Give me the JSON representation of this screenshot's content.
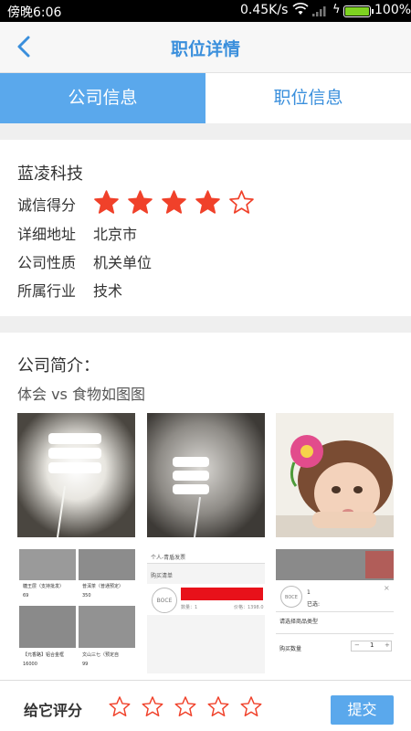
{
  "status_bar": {
    "time": "傍晚6:06",
    "speed": "0.45K/s",
    "battery": "100%"
  },
  "nav": {
    "title": "职位详情"
  },
  "tabs": [
    {
      "label": "公司信息"
    },
    {
      "label": "职位信息"
    }
  ],
  "company": {
    "name": "蓝凌科技",
    "rating_label": "诚信得分",
    "rating": 4,
    "rating_max": 5,
    "address_label": "详细地址",
    "address": "北京市",
    "nature_label": "公司性质",
    "nature": "机关单位",
    "industry_label": "所属行业",
    "industry": "技术"
  },
  "intro": {
    "title": "公司简介：",
    "text": "体会 vs 食物如图图",
    "shot1": {
      "cells": [
        {
          "name": "糖王层（支持批发）",
          "price": "69"
        },
        {
          "name": "普洱茶（普通预定）",
          "price": "350"
        },
        {
          "name": "【元香路】铝合金框",
          "price": "16000"
        },
        {
          "name": "文山三七（预定自",
          "price": "99"
        }
      ]
    },
    "shot2": {
      "header": "个人-青盾发票",
      "subheader": "购买清单",
      "logo": "BOCE",
      "qty": "数量：1",
      "price": "价格：1398.0"
    },
    "shot3": {
      "logo": "BOCE",
      "qty_value": "1",
      "selected": "已选:",
      "choose": "请选择商品类型",
      "buy_qty": "购买数量",
      "minus": "−",
      "stepper_value": "1",
      "plus": "+"
    }
  },
  "footer": {
    "rate_label": "给它评分",
    "submit_label": "提交"
  },
  "colors": {
    "accent": "#5aa8ec",
    "title_blue": "#3a8fdc",
    "star_red": "#f0412a"
  }
}
